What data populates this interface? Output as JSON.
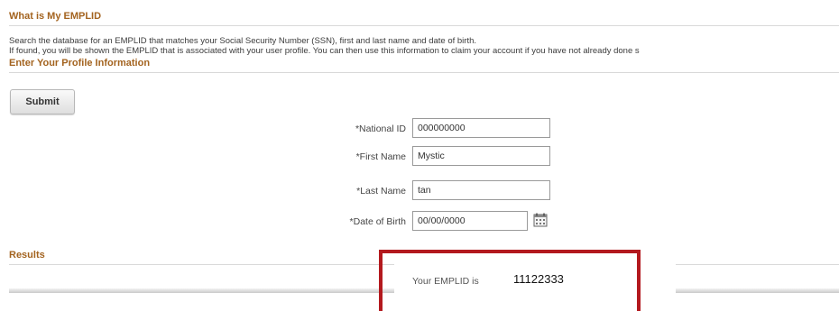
{
  "sections": {
    "emplid_title": "What is My EMPLID",
    "profile_title": "Enter Your Profile Information",
    "results_title": "Results"
  },
  "description": {
    "line1": "Search the database for an EMPLID that matches your Social Security Number (SSN), first and last name and date of birth.",
    "line2": "If found, you will be shown the EMPLID that is associated with your user profile. You can then use this information to claim your account if you have not already done s"
  },
  "buttons": {
    "submit": "Submit"
  },
  "form": {
    "national_id": {
      "required_mark": "*",
      "label": "National ID",
      "value": "000000000"
    },
    "first_name": {
      "required_mark": "*",
      "label": "First Name",
      "value": "Mystic"
    },
    "last_name": {
      "required_mark": "*",
      "label": "Last Name",
      "value": "tan"
    },
    "dob": {
      "required_mark": "*",
      "label": "Date of Birth",
      "value": "00/00/0000",
      "icon": "calendar-icon"
    }
  },
  "results": {
    "label": "Your EMPLID is",
    "value": "11122333"
  },
  "colors": {
    "section_title": "#a3631f",
    "highlight_border": "#b3191e"
  }
}
